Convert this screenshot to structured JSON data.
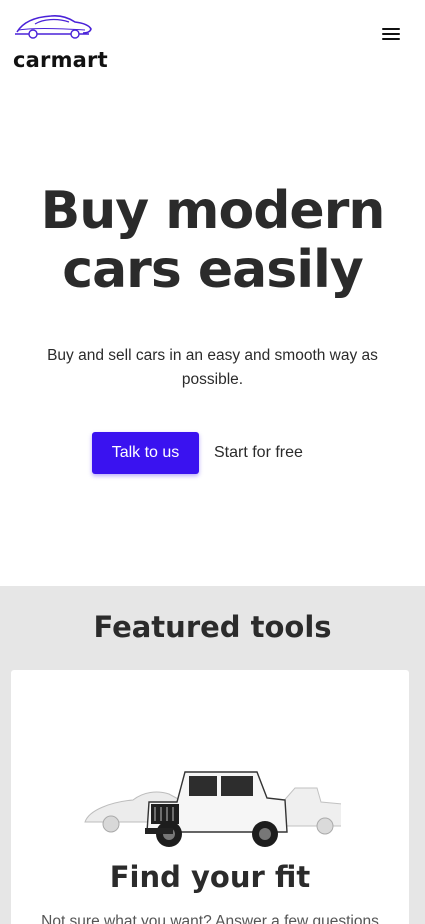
{
  "brand": {
    "name": "carmart",
    "logo_icon": "car-outline-icon",
    "accent": "#3a12f0"
  },
  "header": {
    "menu_icon": "hamburger-menu-icon"
  },
  "hero": {
    "title_line1": "Buy modern",
    "title_line2": "cars easily",
    "subtitle": "Buy and sell cars in an easy and smooth way as possible.",
    "primary_cta": "Talk to us",
    "secondary_cta": "Start for free"
  },
  "featured": {
    "title": "Featured tools",
    "card": {
      "image": "cars-lineup-image",
      "title": "Find your fit",
      "description": "Not sure what you want? Answer a few questions"
    }
  }
}
